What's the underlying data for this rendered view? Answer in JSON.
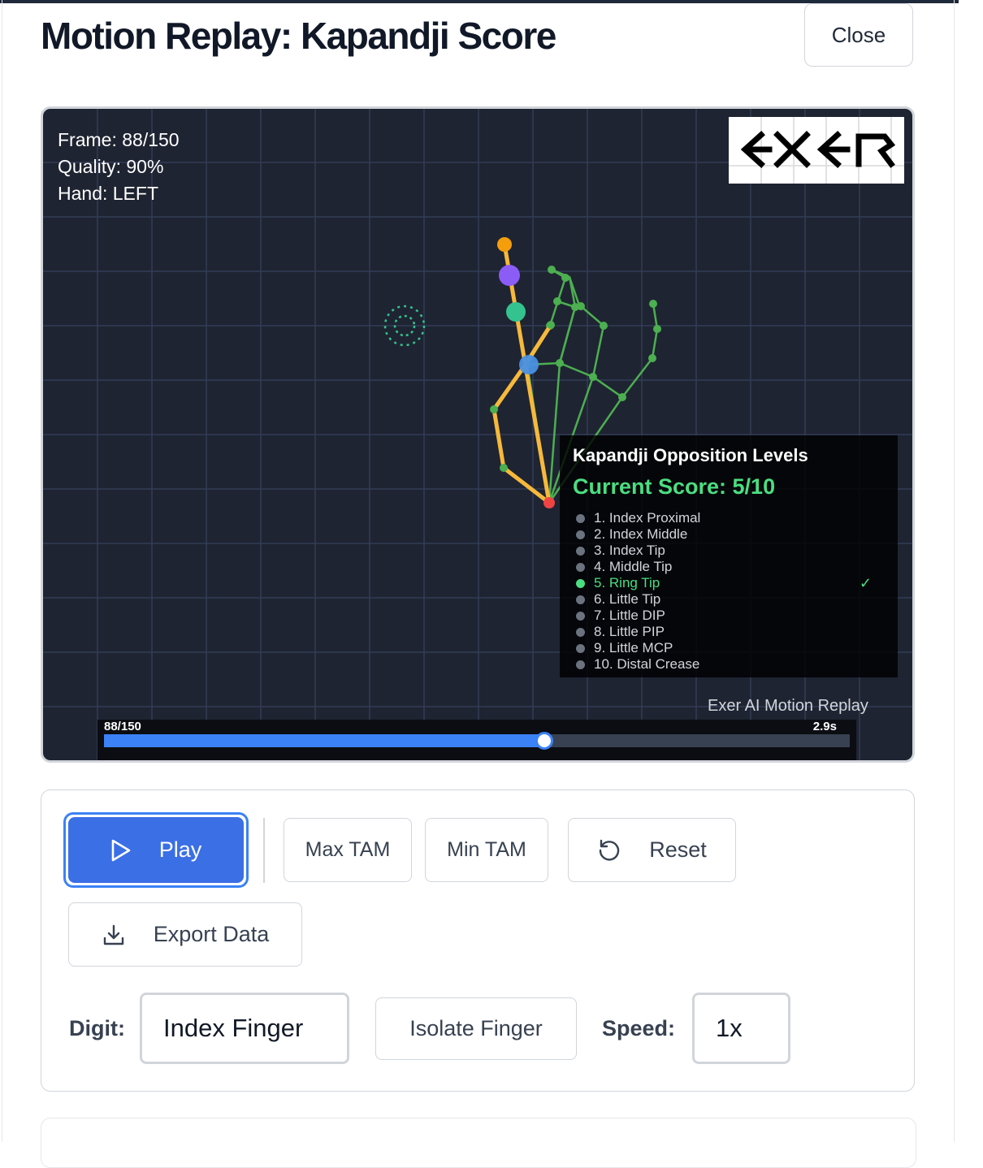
{
  "title": "Motion Replay: Kapandji Score",
  "close_label": "Close",
  "viewer": {
    "frame_text": "Frame: 88/150",
    "quality_text": "Quality: 90%",
    "hand_text": "Hand: LEFT",
    "logo_text": "EXER",
    "watermark": "Exer AI Motion Replay",
    "panel": {
      "title": "Kapandji Opposition Levels",
      "score": "Current Score: 5/10",
      "levels": [
        {
          "label": "1. Index Proximal",
          "active": false
        },
        {
          "label": "2. Index Middle",
          "active": false
        },
        {
          "label": "3. Index Tip",
          "active": false
        },
        {
          "label": "4. Middle Tip",
          "active": false
        },
        {
          "label": "5. Ring Tip",
          "active": true,
          "check": "✓"
        },
        {
          "label": "6. Little Tip",
          "active": false
        },
        {
          "label": "7. Little DIP",
          "active": false
        },
        {
          "label": "8. Little PIP",
          "active": false
        },
        {
          "label": "9. Little MCP",
          "active": false
        },
        {
          "label": "10. Distal Crease",
          "active": false
        }
      ]
    },
    "timeline": {
      "frame_label": "88/150",
      "time_label": "2.9s",
      "progress": 0.5867
    }
  },
  "controls": {
    "play_label": "Play",
    "max_tam_label": "Max TAM",
    "min_tam_label": "Min TAM",
    "reset_label": "Reset",
    "export_label": "Export Data",
    "digit_label": "Digit:",
    "digit_value": "Index Finger",
    "isolate_label": "Isolate Finger",
    "speed_label": "Speed:",
    "speed_value": "1x"
  },
  "colors": {
    "accent": "#3b6fe6",
    "thumb": "#f6b93b",
    "fingers": "#4caf50",
    "score_green": "#4ade80",
    "canvas_bg": "#1f2432"
  },
  "icons": [
    "play-icon",
    "reset-icon",
    "download-icon",
    "exer-logo"
  ]
}
